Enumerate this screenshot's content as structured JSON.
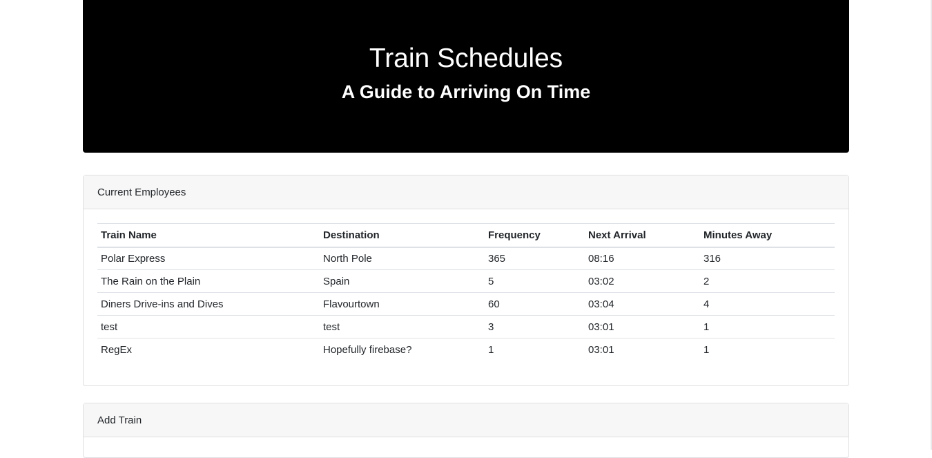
{
  "header": {
    "title": "Train Schedules",
    "subtitle": "A Guide to Arriving On Time"
  },
  "schedule": {
    "title": "Current Employees",
    "columns": [
      "Train Name",
      "Destination",
      "Frequency",
      "Next Arrival",
      "Minutes Away"
    ],
    "rows": [
      [
        "Polar Express",
        "North Pole",
        "365",
        "08:16",
        "316"
      ],
      [
        "The Rain on the Plain",
        "Spain",
        "5",
        "03:02",
        "2"
      ],
      [
        "Diners Drive-ins and Dives",
        "Flavourtown",
        "60",
        "03:04",
        "4"
      ],
      [
        "test",
        "test",
        "3",
        "03:01",
        "1"
      ],
      [
        "RegEx",
        "Hopefully firebase?",
        "1",
        "03:01",
        "1"
      ]
    ]
  },
  "add_train": {
    "title": "Add Train"
  }
}
